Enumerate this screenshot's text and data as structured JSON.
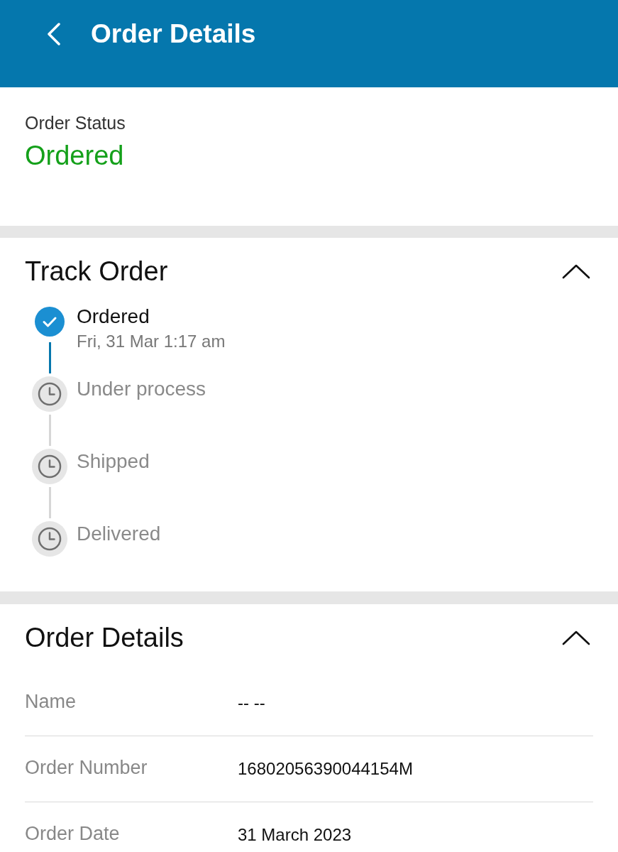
{
  "header": {
    "title": "Order Details"
  },
  "status": {
    "label": "Order Status",
    "value": "Ordered"
  },
  "track": {
    "title": "Track Order",
    "expanded": true,
    "steps": [
      {
        "label": "Ordered",
        "time": "Fri, 31 Mar 1:17 am",
        "done": true
      },
      {
        "label": "Under process",
        "done": false
      },
      {
        "label": "Shipped",
        "done": false
      },
      {
        "label": "Delivered",
        "done": false
      }
    ]
  },
  "details": {
    "title": "Order Details",
    "expanded": true,
    "rows": [
      {
        "label": "Name",
        "value": "-- --"
      },
      {
        "label": "Order Number",
        "value": "16802056390044154M"
      },
      {
        "label": "Order Date",
        "value": "31 March 2023"
      }
    ]
  }
}
